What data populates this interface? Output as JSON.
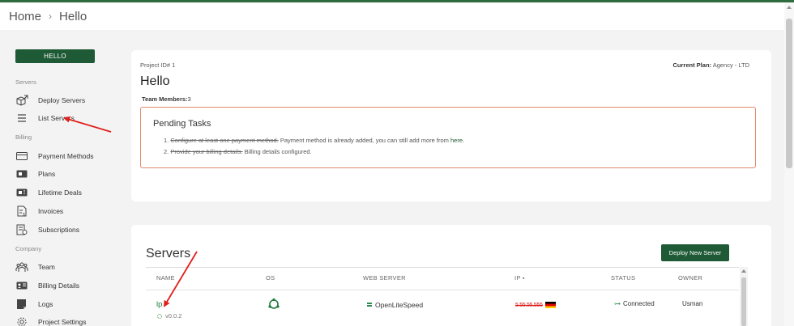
{
  "header": {
    "breadcrumb_home": "Home",
    "breadcrumb_sep": "›",
    "breadcrumb_current": "Hello"
  },
  "sidebar": {
    "project_button": "HELLO",
    "sections": [
      {
        "label": "Servers",
        "items": [
          {
            "label": "Deploy Servers",
            "icon": "cube-icon"
          },
          {
            "label": "List Servers",
            "icon": "list-icon"
          }
        ]
      },
      {
        "label": "Billing",
        "items": [
          {
            "label": "Payment Methods",
            "icon": "credit-card-icon"
          },
          {
            "label": "Plans",
            "icon": "plan-icon"
          },
          {
            "label": "Lifetime Deals",
            "icon": "deal-icon"
          },
          {
            "label": "Invoices",
            "icon": "invoice-icon"
          },
          {
            "label": "Subscriptions",
            "icon": "subscription-icon"
          }
        ]
      },
      {
        "label": "Company",
        "items": [
          {
            "label": "Team",
            "icon": "team-icon"
          },
          {
            "label": "Billing Details",
            "icon": "id-card-icon"
          },
          {
            "label": "Logs",
            "icon": "logs-icon"
          },
          {
            "label": "Project Settings",
            "icon": "gear-icon"
          }
        ]
      }
    ]
  },
  "project": {
    "id_label": "Project ID# 1",
    "plan_label": "Current Plan:",
    "plan_value": "Agency - LTD",
    "name": "Hello",
    "team_label": "Team Members:",
    "team_count": "3",
    "pending_title": "Pending Tasks",
    "tasks": [
      {
        "num": "1.",
        "struck": "Configure at least one payment method.",
        "text": " Payment method is already added, you can still add more from ",
        "link": "here",
        "after": "."
      },
      {
        "num": "2.",
        "struck": "Provide your billing details.",
        "text": " Billing details configured.",
        "link": "",
        "after": ""
      }
    ]
  },
  "servers": {
    "title": "Servers",
    "deploy_button": "Deploy New Server",
    "columns": [
      "NAME",
      "OS",
      "WEB SERVER",
      "IP ⬩",
      "STATUS",
      "OWNER"
    ],
    "rows": [
      {
        "name": "lp",
        "version": "v0.0.2",
        "os_icon": "ubuntu-icon",
        "web_server": "OpenLiteSpeed",
        "ip": "5.55.55.555",
        "flag": "germany-flag-icon",
        "status": "Connected",
        "owner": "Usman"
      }
    ]
  },
  "colors": {
    "brand": "#1e5a36",
    "link": "#1e7a3c",
    "pending_border": "#e28a6a",
    "annotation_arrow": "#e0201c"
  }
}
